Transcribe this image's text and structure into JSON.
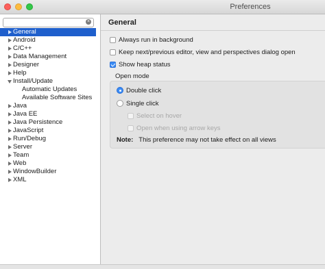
{
  "window": {
    "title": "Preferences"
  },
  "search": {
    "value": "",
    "placeholder": ""
  },
  "tree": [
    {
      "label": "General",
      "level": 0,
      "arrow": "right",
      "selected": true
    },
    {
      "label": "Android",
      "level": 0,
      "arrow": "right"
    },
    {
      "label": "C/C++",
      "level": 0,
      "arrow": "right"
    },
    {
      "label": "Data Management",
      "level": 0,
      "arrow": "right"
    },
    {
      "label": "Designer",
      "level": 0,
      "arrow": "right"
    },
    {
      "label": "Help",
      "level": 0,
      "arrow": "right"
    },
    {
      "label": "Install/Update",
      "level": 0,
      "arrow": "down"
    },
    {
      "label": "Automatic Updates",
      "level": 1,
      "arrow": "none"
    },
    {
      "label": "Available Software Sites",
      "level": 1,
      "arrow": "none"
    },
    {
      "label": "Java",
      "level": 0,
      "arrow": "right"
    },
    {
      "label": "Java EE",
      "level": 0,
      "arrow": "right"
    },
    {
      "label": "Java Persistence",
      "level": 0,
      "arrow": "right"
    },
    {
      "label": "JavaScript",
      "level": 0,
      "arrow": "right"
    },
    {
      "label": "Run/Debug",
      "level": 0,
      "arrow": "right"
    },
    {
      "label": "Server",
      "level": 0,
      "arrow": "right"
    },
    {
      "label": "Team",
      "level": 0,
      "arrow": "right"
    },
    {
      "label": "Web",
      "level": 0,
      "arrow": "right"
    },
    {
      "label": "WindowBuilder",
      "level": 0,
      "arrow": "right"
    },
    {
      "label": "XML",
      "level": 0,
      "arrow": "right"
    }
  ],
  "page": {
    "title": "General",
    "checkboxes": [
      {
        "label": "Always run in background",
        "checked": false
      },
      {
        "label": "Keep next/previous editor, view and perspectives dialog open",
        "checked": false
      },
      {
        "label": "Show heap status",
        "checked": true
      }
    ],
    "open_mode": {
      "title": "Open mode",
      "options": [
        {
          "label": "Double click",
          "selected": true
        },
        {
          "label": "Single click",
          "selected": false
        }
      ],
      "sub_options": [
        {
          "label": "Select on hover",
          "checked": false,
          "disabled": true
        },
        {
          "label": "Open when using arrow keys",
          "checked": false,
          "disabled": true
        }
      ],
      "note_label": "Note:",
      "note_text": "This preference may not take effect on all views"
    }
  }
}
